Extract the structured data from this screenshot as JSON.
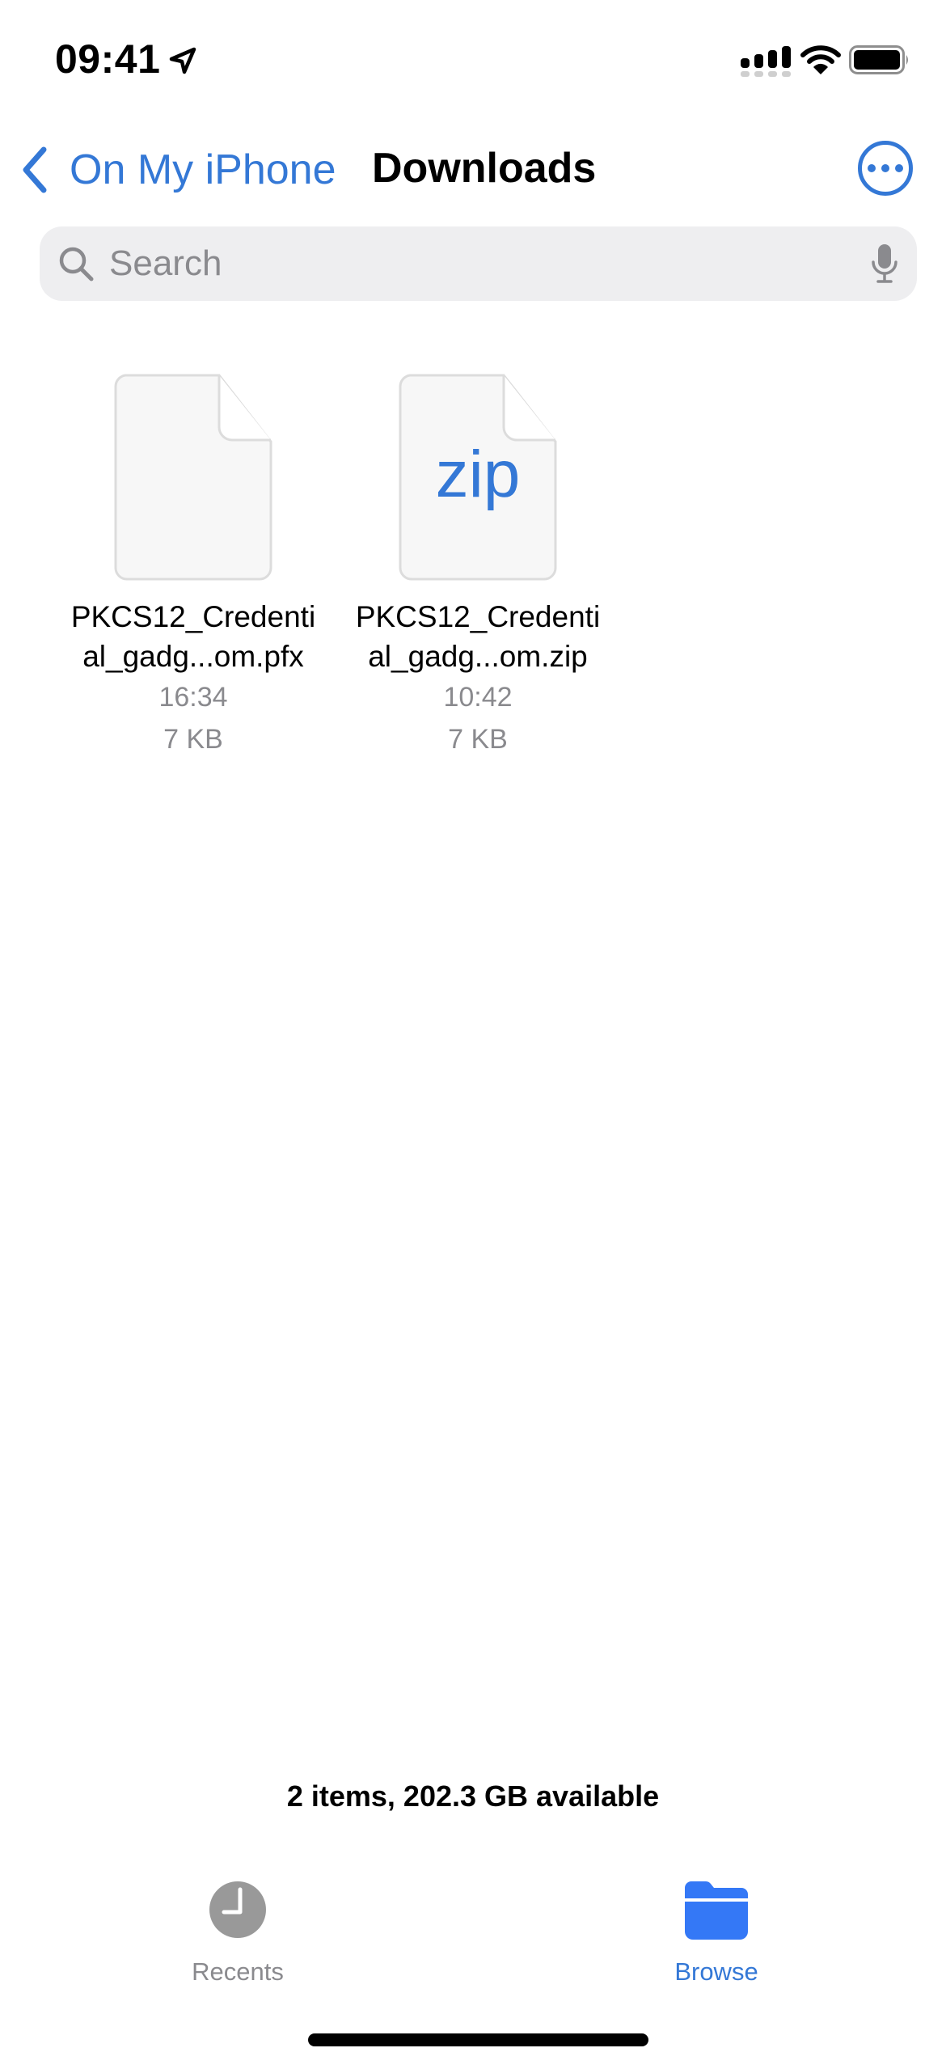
{
  "status_bar": {
    "time": "09:41",
    "location_icon": "location-arrow-icon",
    "signal_icon": "cellular-signal-icon",
    "wifi_icon": "wifi-icon",
    "battery_icon": "battery-full-icon"
  },
  "nav": {
    "back_label": "On My iPhone",
    "title": "Downloads",
    "more_icon": "ellipsis-circle-icon"
  },
  "search": {
    "placeholder": "Search",
    "value": ""
  },
  "files": [
    {
      "name_line1": "PKCS12_Credenti",
      "name_line2": "al_gadg...om.pfx",
      "time": "16:34",
      "size": "7 KB",
      "icon": "generic-document-icon"
    },
    {
      "name_line1": "PKCS12_Credenti",
      "name_line2": "al_gadg...om.zip",
      "time": "10:42",
      "size": "7 KB",
      "icon": "zip-document-icon",
      "badge": "zip"
    }
  ],
  "footer": {
    "status": "2 items, 202.3 GB available"
  },
  "tabs": [
    {
      "label": "Recents",
      "icon": "clock-icon",
      "active": false
    },
    {
      "label": "Browse",
      "icon": "folder-icon",
      "active": true
    }
  ],
  "colors": {
    "accent": "#3478d6",
    "tab_active": "#3478f6",
    "inactive": "#8a8a8e",
    "search_bg": "#eeeef0"
  }
}
